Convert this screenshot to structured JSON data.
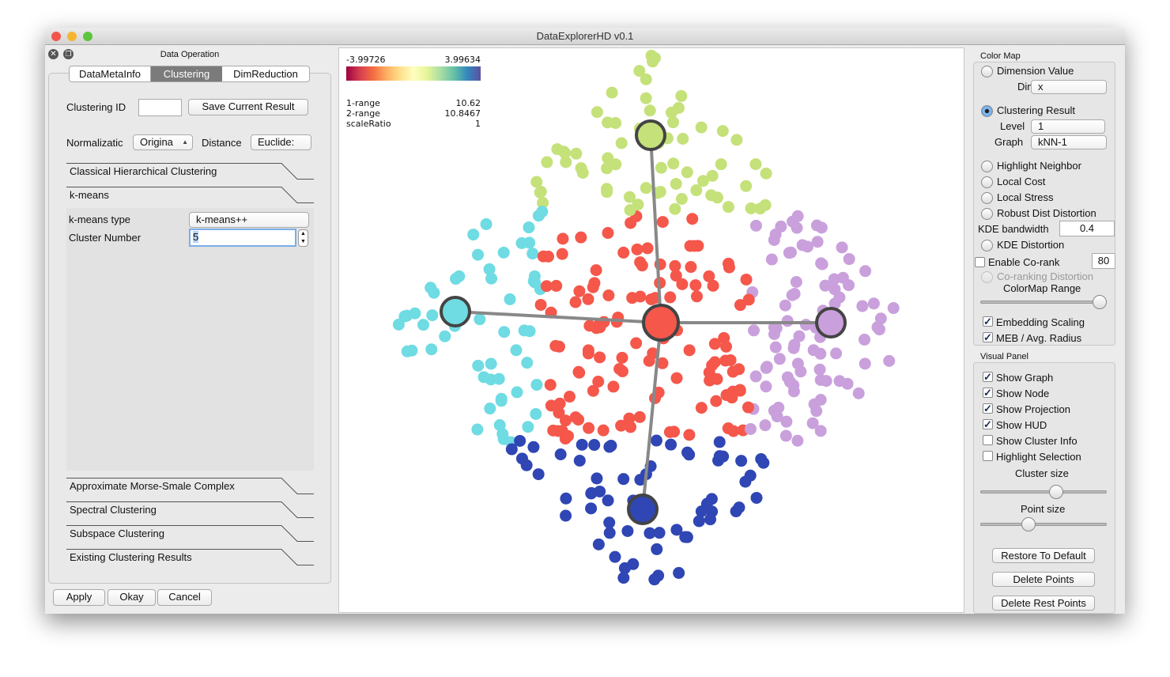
{
  "window": {
    "title": "DataExplorerHD v0.1"
  },
  "left": {
    "dock_title": "Data Operation",
    "tabs": [
      {
        "label": "DataMetaInfo",
        "active": false
      },
      {
        "label": "Clustering",
        "active": true
      },
      {
        "label": "DimReduction",
        "active": false
      }
    ],
    "clustering_id_label": "Clustering ID",
    "clustering_id_value": "",
    "save_button": "Save Current Result",
    "normalization_label": "Normalizatic",
    "normalization_value": "Origina",
    "distance_label": "Distance",
    "distance_value": "Euclide:",
    "sections": [
      "Classical Hierarchical Clustering",
      "k-means",
      "Approximate Morse-Smale Complex",
      "Spectral Clustering",
      "Subspace Clustering",
      "Existing Clustering Results"
    ],
    "kmeans_type_label": "k-means type",
    "kmeans_type_value": "k-means++",
    "cluster_number_label": "Cluster Number",
    "cluster_number_value": "5",
    "apply": "Apply",
    "okay": "Okay",
    "cancel": "Cancel"
  },
  "hud": {
    "min": "-3.99726",
    "max": "3.99634",
    "rows": [
      {
        "k": "1-range",
        "v": "10.62"
      },
      {
        "k": "2-range",
        "v": "10.8467"
      },
      {
        "k": "scaleRatio",
        "v": "1"
      }
    ]
  },
  "clusters": [
    {
      "color": "#c5e17a"
    },
    {
      "color": "#6fdbe3"
    },
    {
      "color": "#f5574b"
    },
    {
      "color": "#c9a0dc"
    },
    {
      "color": "#2f46b4"
    }
  ],
  "right": {
    "colormap_title": "Color Map",
    "dimension_value": "Dimension Value",
    "dim_label": "Dim",
    "dim_value": "x",
    "clustering_result": "Clustering Result",
    "level_label": "Level",
    "level_value": "1",
    "graph_label": "Graph",
    "graph_value": "kNN-1",
    "highlight_neighbor": "Highlight Neighbor",
    "local_cost": "Local Cost",
    "local_stress": "Local Stress",
    "robust": "Robust Dist Distortion",
    "kde_label": "KDE bandwidth",
    "kde_value": "0.4",
    "kde_distortion": "KDE Distortion",
    "corank_label": "Enable Co-rank",
    "corank_value": "80",
    "coranking": "Co-ranking Distortion",
    "colormap_range": "ColorMap Range",
    "colormap_range_value": 1.0,
    "embedding_scaling": "Embedding Scaling",
    "meb": "MEB / Avg. Radius",
    "visual_title": "Visual Panel",
    "checks": [
      {
        "label": "Show Graph",
        "checked": true
      },
      {
        "label": "Show Node",
        "checked": true
      },
      {
        "label": "Show Projection",
        "checked": true
      },
      {
        "label": "Show HUD",
        "checked": true
      },
      {
        "label": "Show Cluster Info",
        "checked": false
      },
      {
        "label": "Highlight Selection",
        "checked": false
      }
    ],
    "cluster_size": "Cluster size",
    "cluster_size_value": 0.63,
    "point_size": "Point size",
    "point_size_value": 0.4,
    "restore": "Restore To Default",
    "delete": "Delete Points",
    "delete_rest": "Delete Rest Points"
  }
}
